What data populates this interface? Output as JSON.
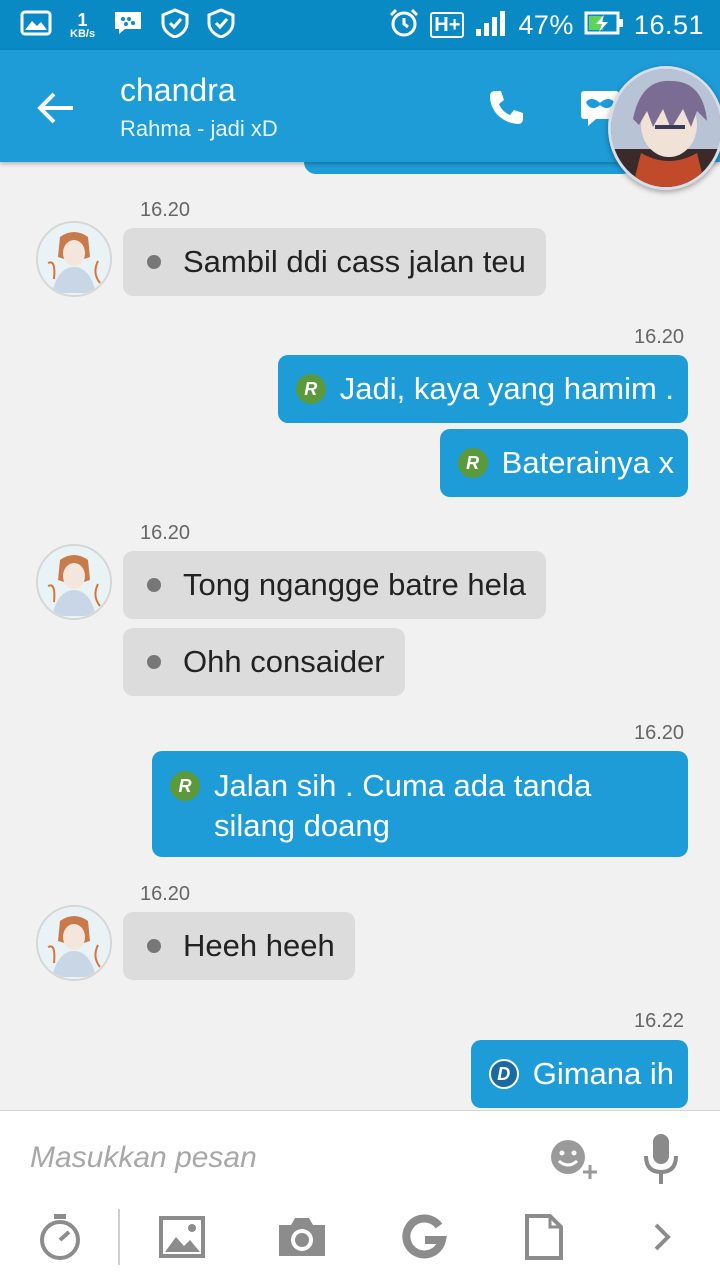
{
  "status_bar": {
    "net_speed_value": "1",
    "net_speed_unit": "KB/s",
    "network_type": "H+",
    "battery": "47%",
    "time": "16.51"
  },
  "header": {
    "contact_name": "chandra",
    "status_message": "Rahma - jadi xD"
  },
  "messages": [
    {
      "time": "16.20",
      "text": "Sambil ddi cass jalan teu"
    },
    {
      "time": "16.20",
      "text": "Jadi, kaya yang hamim .",
      "badge": "R"
    },
    {
      "text": "Baterainya x",
      "badge": "R"
    },
    {
      "time": "16.20",
      "text": "Tong ngangge batre hela"
    },
    {
      "text": "Ohh consaider"
    },
    {
      "time": "16.20",
      "text_line1": "Jalan sih . Cuma ada tanda",
      "text_line2": "silang doang",
      "badge": "R"
    },
    {
      "time": "16.20",
      "text": "Heeh heeh"
    },
    {
      "time": "16.22",
      "text": "Gimana ih",
      "badge": "D"
    }
  ],
  "composer": {
    "placeholder": "Masukkan pesan"
  },
  "colors": {
    "status_bar": "#0a8ac4",
    "app_bar": "#1e9cd8",
    "outgoing_bubble": "#1e9cd8",
    "incoming_bubble": "#dcdcdc",
    "badge_r": "#5b9a3c",
    "badge_d": "#1a6aa1"
  },
  "icons": {
    "status_left": [
      "image-icon",
      "bbm-icon",
      "shield-icon",
      "shield-icon"
    ],
    "status_right": [
      "alarm-icon",
      "signal-icon",
      "battery-charging-icon"
    ],
    "header": [
      "back-arrow-icon",
      "phone-icon",
      "mask-icon"
    ],
    "composer": [
      "emoji-add-icon",
      "mic-icon",
      "timer-icon",
      "gallery-icon",
      "camera-icon",
      "google-icon",
      "document-icon",
      "chevron-right-icon"
    ]
  }
}
